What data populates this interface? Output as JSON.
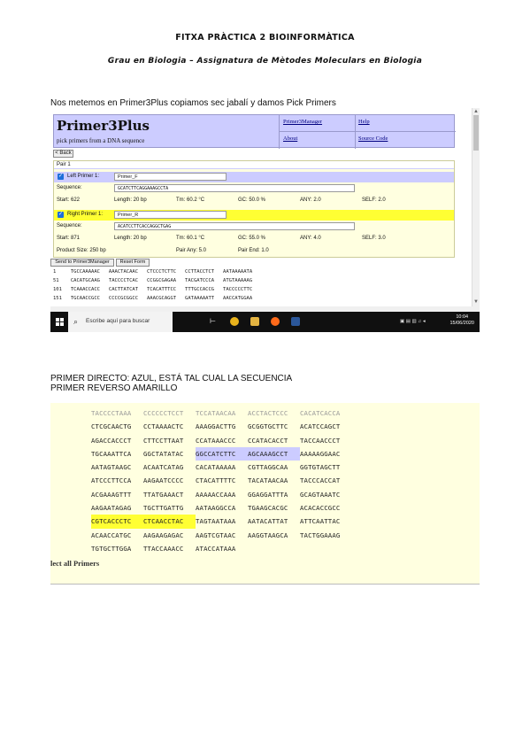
{
  "document": {
    "title": "FITXA PRÀCTICA 2 BIOINFORMÀTICA",
    "subtitle": "Grau en Biologia – Assignatura de Mètodes Moleculars en Biologia",
    "caption1": "Nos metemos en Primer3Plus copiamos sec jabalí y damos Pick Primers",
    "caption2_line1": "PRIMER DIRECTO: AZUL, ESTÁ TAL CUAL LA SECUENCIA",
    "caption2_line2": "PRIMER REVERSO AMARILLO"
  },
  "primer3plus": {
    "logo": "Primer3Plus",
    "tagline": "pick primers from a DNA sequence",
    "links": {
      "manager": "Primer3Manager",
      "help": "Help",
      "about": "About",
      "source": "Source Code"
    },
    "back_label": "< Back",
    "pair_label": "Pair 1",
    "left_primer": {
      "label": "Left Primer 1:",
      "name": "Primer_F",
      "sequence_label": "Sequence:",
      "sequence": "GCATCTTCAGGAAAGCCTA",
      "start": "Start: 622",
      "length": "Length: 20 bp",
      "tm": "Tm: 60.2 °C",
      "gc": "GC: 50.0 %",
      "any": "ANY: 2.0",
      "self": "SELF: 2.0"
    },
    "right_primer": {
      "label": "Right Primer 1:",
      "name": "Primer_R",
      "sequence_label": "Sequence:",
      "sequence": "ACATCCTTCACCAGGCTGAG",
      "start": "Start: 871",
      "length": "Length: 20 bp",
      "tm": "Tm: 60.1 °C",
      "gc": "GC: 55.0 %",
      "any": "ANY: 4.0",
      "self": "SELF: 3.0"
    },
    "product_size": "Product Size: 250 bp",
    "pair_any": "Pair Any: 5.0",
    "pair_end": "Pair End: 1.0",
    "send_btn": "Send to Primer3Manager",
    "reset_btn": "Reset Form",
    "preview_lines": [
      "1     TGCCAAAAAC   AAACTACAAC   CTCCCTCTTC   CCTTACCTCT   AATAAAAATA",
      "51    CACATGCAAG   TACCCCTCAC   CCGGCGAGAA   TACGATCCCA   ATGTAAAAAG",
      "101   TCAAACCACC   CACTTATCAT   TCACATTTCC   TTTGCCACCG   TACCCCCTTC",
      "151   TGCAACCGCC   CCCCGCGGCC   AAACGCAGGT   GATAAAAATT   AACCATGGAA"
    ],
    "taskbar": {
      "search_placeholder": "Escribe aquí para buscar",
      "time": "10:04",
      "date": "15/06/2020"
    }
  },
  "sequence_view": {
    "rows": [
      [
        "TACCCCTAAA",
        "CCCCCCTCCT",
        "TCCATAACAA",
        "ACCTACTCCC",
        "CACATCACCA"
      ],
      [
        "CTCGCAACTG",
        "CCTAAAACTC",
        "AAAGGACTTG",
        "GCGGTGCTTC",
        "ACATCCAGCT"
      ],
      [
        "AGACCACCCT",
        "CTTCCTTAAT",
        "CCATAAACCC",
        "CCATACACCT",
        "TACCAACCCT"
      ],
      [
        "TGCAAATTCA",
        "GGCTATATAC",
        "GGCCATCTTC",
        "AGCAAAGCCT",
        "AAAAAGGAAC"
      ],
      [
        "AATAGTAAGC",
        "ACAATCATAG",
        "CACATAAAAA",
        "CGTTAGGCAA",
        "GGTGTAGCTT"
      ],
      [
        "ATCCCTTCCA",
        "AAGAATCCCC",
        "CTACATTTTC",
        "TACATAACAA",
        "TACCCACCAT"
      ],
      [
        "ACGAAAGTTT",
        "TTATGAAACT",
        "AAAAACCAAA",
        "GGAGGATTTA",
        "GCAGTAAATC"
      ],
      [
        "AAGAATAGAG",
        "TGCTTGATTG",
        "AATAAGGCCA",
        "TGAAGCACGC",
        "ACACACCGCC"
      ],
      [
        "CGTCACCCTC",
        "CTCAACCTAC",
        "TAGTAATAAA",
        "AATACATTAT",
        "ATTCAATTAC"
      ],
      [
        "ACAACCATGC",
        "AAGAAGAGAC",
        "AAGTCGTAAC",
        "AAGGTAAGCA",
        "TACTGGAAAG"
      ],
      [
        "TGTGCTTGGA",
        "TTACCAAACC",
        "ATACCATAAA"
      ]
    ],
    "select_all": "lect all Primers"
  }
}
